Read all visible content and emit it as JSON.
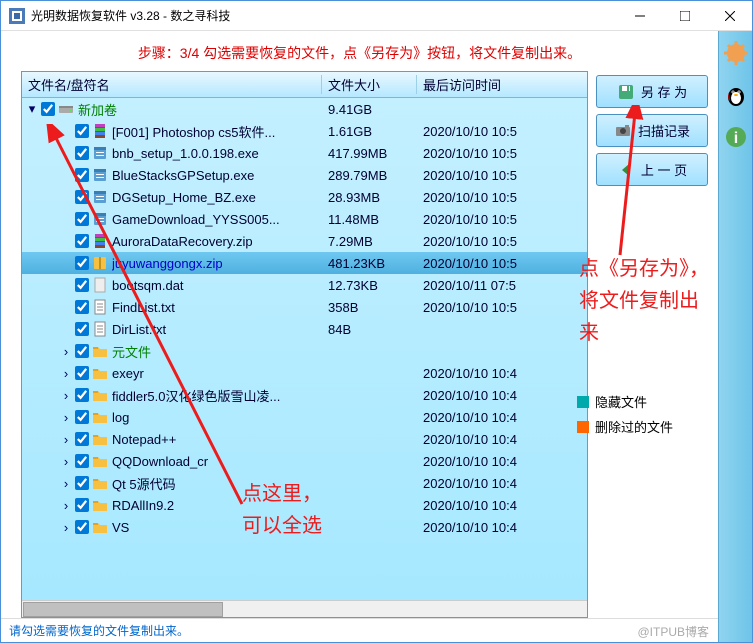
{
  "window": {
    "title": "光明数据恢复软件 v3.28 - 数之寻科技"
  },
  "step_text": "步骤：3/4 勾选需要恢复的文件，点《另存为》按钮，将文件复制出来。",
  "columns": {
    "name": "文件名/盘符名",
    "size": "文件大小",
    "time": "最后访问时间"
  },
  "rows": [
    {
      "level": 0,
      "expand": "▾",
      "name": "新加卷",
      "size": "9.41GB",
      "time": "",
      "icon": "drive",
      "cls": "green-text"
    },
    {
      "level": 1,
      "expand": "",
      "name": "[F001] Photoshop cs5软件...",
      "size": "1.61GB",
      "time": "2020/10/10 10:5",
      "icon": "rar"
    },
    {
      "level": 1,
      "expand": "",
      "name": "bnb_setup_1.0.0.198.exe",
      "size": "417.99MB",
      "time": "2020/10/10 10:5",
      "icon": "exe"
    },
    {
      "level": 1,
      "expand": "",
      "name": "BlueStacksGPSetup.exe",
      "size": "289.79MB",
      "time": "2020/10/10 10:5",
      "icon": "exe"
    },
    {
      "level": 1,
      "expand": "",
      "name": "DGSetup_Home_BZ.exe",
      "size": "28.93MB",
      "time": "2020/10/10 10:5",
      "icon": "exe"
    },
    {
      "level": 1,
      "expand": "",
      "name": "GameDownload_YYSS005...",
      "size": "11.48MB",
      "time": "2020/10/10 10:5",
      "icon": "exe"
    },
    {
      "level": 1,
      "expand": "",
      "name": "AuroraDataRecovery.zip",
      "size": "7.29MB",
      "time": "2020/10/10 10:5",
      "icon": "rar"
    },
    {
      "level": 1,
      "expand": "",
      "name": "juyuwanggongx.zip",
      "size": "481.23KB",
      "time": "2020/10/10 10:5",
      "icon": "zip",
      "selected": true,
      "cls": "blue-text"
    },
    {
      "level": 1,
      "expand": "",
      "name": "bootsqm.dat",
      "size": "12.73KB",
      "time": "2020/10/11 07:5",
      "icon": "dat"
    },
    {
      "level": 1,
      "expand": "",
      "name": "FindList.txt",
      "size": "358B",
      "time": "2020/10/10 10:5",
      "icon": "txt"
    },
    {
      "level": 1,
      "expand": "",
      "name": "DirList.txt",
      "size": "84B",
      "time": "",
      "icon": "txt"
    },
    {
      "level": 1,
      "expand": "›",
      "name": "元文件",
      "size": "",
      "time": "",
      "icon": "folder",
      "cls": "green-text"
    },
    {
      "level": 1,
      "expand": "›",
      "name": "exeyr",
      "size": "",
      "time": "2020/10/10 10:4",
      "icon": "folder"
    },
    {
      "level": 1,
      "expand": "›",
      "name": "fiddler5.0汉化绿色版雪山凌...",
      "size": "",
      "time": "2020/10/10 10:4",
      "icon": "folder"
    },
    {
      "level": 1,
      "expand": "›",
      "name": "log",
      "size": "",
      "time": "2020/10/10 10:4",
      "icon": "folder"
    },
    {
      "level": 1,
      "expand": "›",
      "name": "Notepad++",
      "size": "",
      "time": "2020/10/10 10:4",
      "icon": "folder"
    },
    {
      "level": 1,
      "expand": "›",
      "name": "QQDownload_cr",
      "size": "",
      "time": "2020/10/10 10:4",
      "icon": "folder"
    },
    {
      "level": 1,
      "expand": "›",
      "name": "Qt 5源代码",
      "size": "",
      "time": "2020/10/10 10:4",
      "icon": "folder"
    },
    {
      "level": 1,
      "expand": "›",
      "name": "RDAllIn9.2",
      "size": "",
      "time": "2020/10/10 10:4",
      "icon": "folder"
    },
    {
      "level": 1,
      "expand": "›",
      "name": "VS",
      "size": "",
      "time": "2020/10/10 10:4",
      "icon": "folder"
    }
  ],
  "buttons": {
    "save_as": "另 存 为",
    "scan_log": "扫描记录",
    "prev_page": "上 一 页"
  },
  "legend": {
    "hidden": "隐藏文件",
    "deleted": "删除过的文件"
  },
  "annotations": {
    "select_all": "点这里，\n可以全选",
    "save_copy": "点《另存为》，将文件复制出来"
  },
  "statusbar": "请勾选需要恢复的文件复制出来。",
  "watermark": "@ITPUB博客"
}
